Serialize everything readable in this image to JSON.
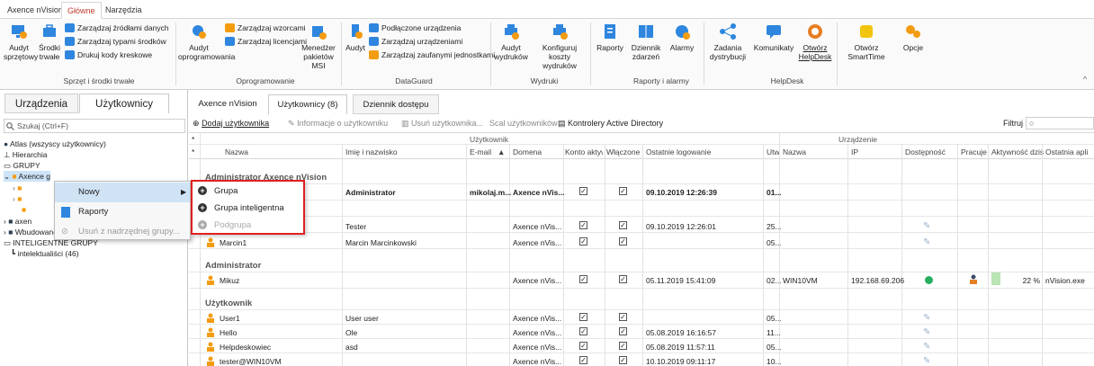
{
  "top_tabs": [
    "Axence nVision",
    "Główne",
    "Narzędzia"
  ],
  "ribbon": {
    "audyt_sprzetowy": "Audyt sprzętowy",
    "srodki_trwale": "Środki trwałe",
    "zarz_zrodlami": "Zarządzaj źródłami danych",
    "zarz_typami": "Zarządzaj typami środków",
    "drukuj_kody": "Drukuj kody kreskowe",
    "grp_sprzet": "Sprzęt i środki trwałe",
    "audyt_oprog": "Audyt oprogramowania",
    "zarz_wzorcami": "Zarządzaj wzorcami",
    "zarz_licencjami": "Zarządzaj licencjami",
    "menedzer_msi": "Menedżer pakietów MSI",
    "grp_oprog": "Oprogramowanie",
    "audyt": "Audyt",
    "podlaczone": "Podłączone urządzenia",
    "zarz_urzadzeniami": "Zarządzaj urządzeniami",
    "zarz_zaufanymi": "Zarządzaj zaufanymi jednostkami",
    "grp_dataguard": "DataGuard",
    "audyt_wydrukow": "Audyt wydruków",
    "konfiguruj_koszty": "Konfiguruj koszty wydruków",
    "grp_wydruki": "Wydruki",
    "raporty": "Raporty",
    "dziennik_zdarzen": "Dziennik zdarzeń",
    "alarmy": "Alarmy",
    "grp_raporty": "Raporty i alarmy",
    "zadania_dystrybucji": "Zadania dystrybucji",
    "komunikaty": "Komunikaty",
    "otworz_helpdesk": "Otwórz HelpDesk",
    "grp_helpdesk": "HelpDesk",
    "otworz_smarttime": "Otwórz SmartTime",
    "opcje": "Opcje"
  },
  "left": {
    "tab_urzadzenia": "Urządzenia",
    "tab_uzytkownicy": "Użytkownicy",
    "search_placeholder": "Szukaj (Ctrl+F)",
    "tree": [
      "Atlas (wszyscy użytkownicy)",
      "Hierarchia",
      "GRUPY",
      "Axence główna",
      "axen",
      "Wbudowane",
      "INTELIGENTNE GRUPY",
      "intelektualiści (46)"
    ]
  },
  "context_menu": {
    "nowy": "Nowy",
    "raporty": "Raporty",
    "usun": "Usuń z nadrzędnej grupy..."
  },
  "submenu": {
    "grupa": "Grupa",
    "grupa_int": "Grupa inteligentna",
    "podgrupa": "Podgrupa"
  },
  "content_tabs": [
    "Axence nVision",
    "Użytkownicy (8)",
    "Dziennik dostępu"
  ],
  "toolbar": {
    "dodaj": "Dodaj użytkownika",
    "informacje": "Informacje o użytkowniku",
    "usun": "Usuń użytkownika...",
    "scal": "Scal użytkowników",
    "kontrolery": "Kontrolery Active Directory",
    "filtruj": "Filtruj"
  },
  "grid": {
    "grp_uzytkownik": "Użytkownik",
    "grp_urzadzenie": "Urządzenie",
    "columns": [
      "Nazwa",
      "Imię i nazwisko",
      "E-mail",
      "Domena",
      "Konto aktyw",
      "Włączone",
      "Ostatnie logowanie",
      "Utw",
      "Nazwa",
      "IP",
      "Dostępność",
      "Pracuje",
      "Aktywność dziś",
      "Ostatnia apli"
    ],
    "groups": [
      "Administrator Axence nVision",
      "Administrator",
      "Użytkownik"
    ],
    "rows": [
      {
        "name": "",
        "full": "Administrator",
        "email": "mikolaj.m...",
        "domain": "Axence nVis...",
        "login": "09.10.2019 12:26:39",
        "utw": "01..."
      },
      {
        "name": "",
        "full": "Tester",
        "email": "",
        "domain": "Axence nVis...",
        "login": "09.10.2019 12:26:01",
        "utw": "25..."
      },
      {
        "name": "Marcin1",
        "full": "Marcin Marcinkowski",
        "email": "",
        "domain": "Axence nVis...",
        "login": "",
        "utw": "05..."
      },
      {
        "name": "Mikuz",
        "full": "",
        "email": "",
        "domain": "Axence nVis...",
        "login": "05.11.2019 15:41:09",
        "utw": "02...",
        "dev": "WIN10VM",
        "ip": "192.168.69.206",
        "act": "22 %",
        "app": "nVision.exe"
      },
      {
        "name": "User1",
        "full": "User user",
        "email": "",
        "domain": "Axence nVis...",
        "login": "",
        "utw": "05..."
      },
      {
        "name": "Hello",
        "full": "Ole",
        "email": "",
        "domain": "Axence nVis...",
        "login": "05.08.2019 16:16:57",
        "utw": "11..."
      },
      {
        "name": "Helpdeskowiec",
        "full": "asd",
        "email": "",
        "domain": "Axence nVis...",
        "login": "05.08.2019 11:57:11",
        "utw": "05..."
      },
      {
        "name": "tester@WIN10VM",
        "full": "",
        "email": "",
        "domain": "Axence nVis...",
        "login": "10.10.2019 09:11:17",
        "utw": "10..."
      }
    ]
  }
}
